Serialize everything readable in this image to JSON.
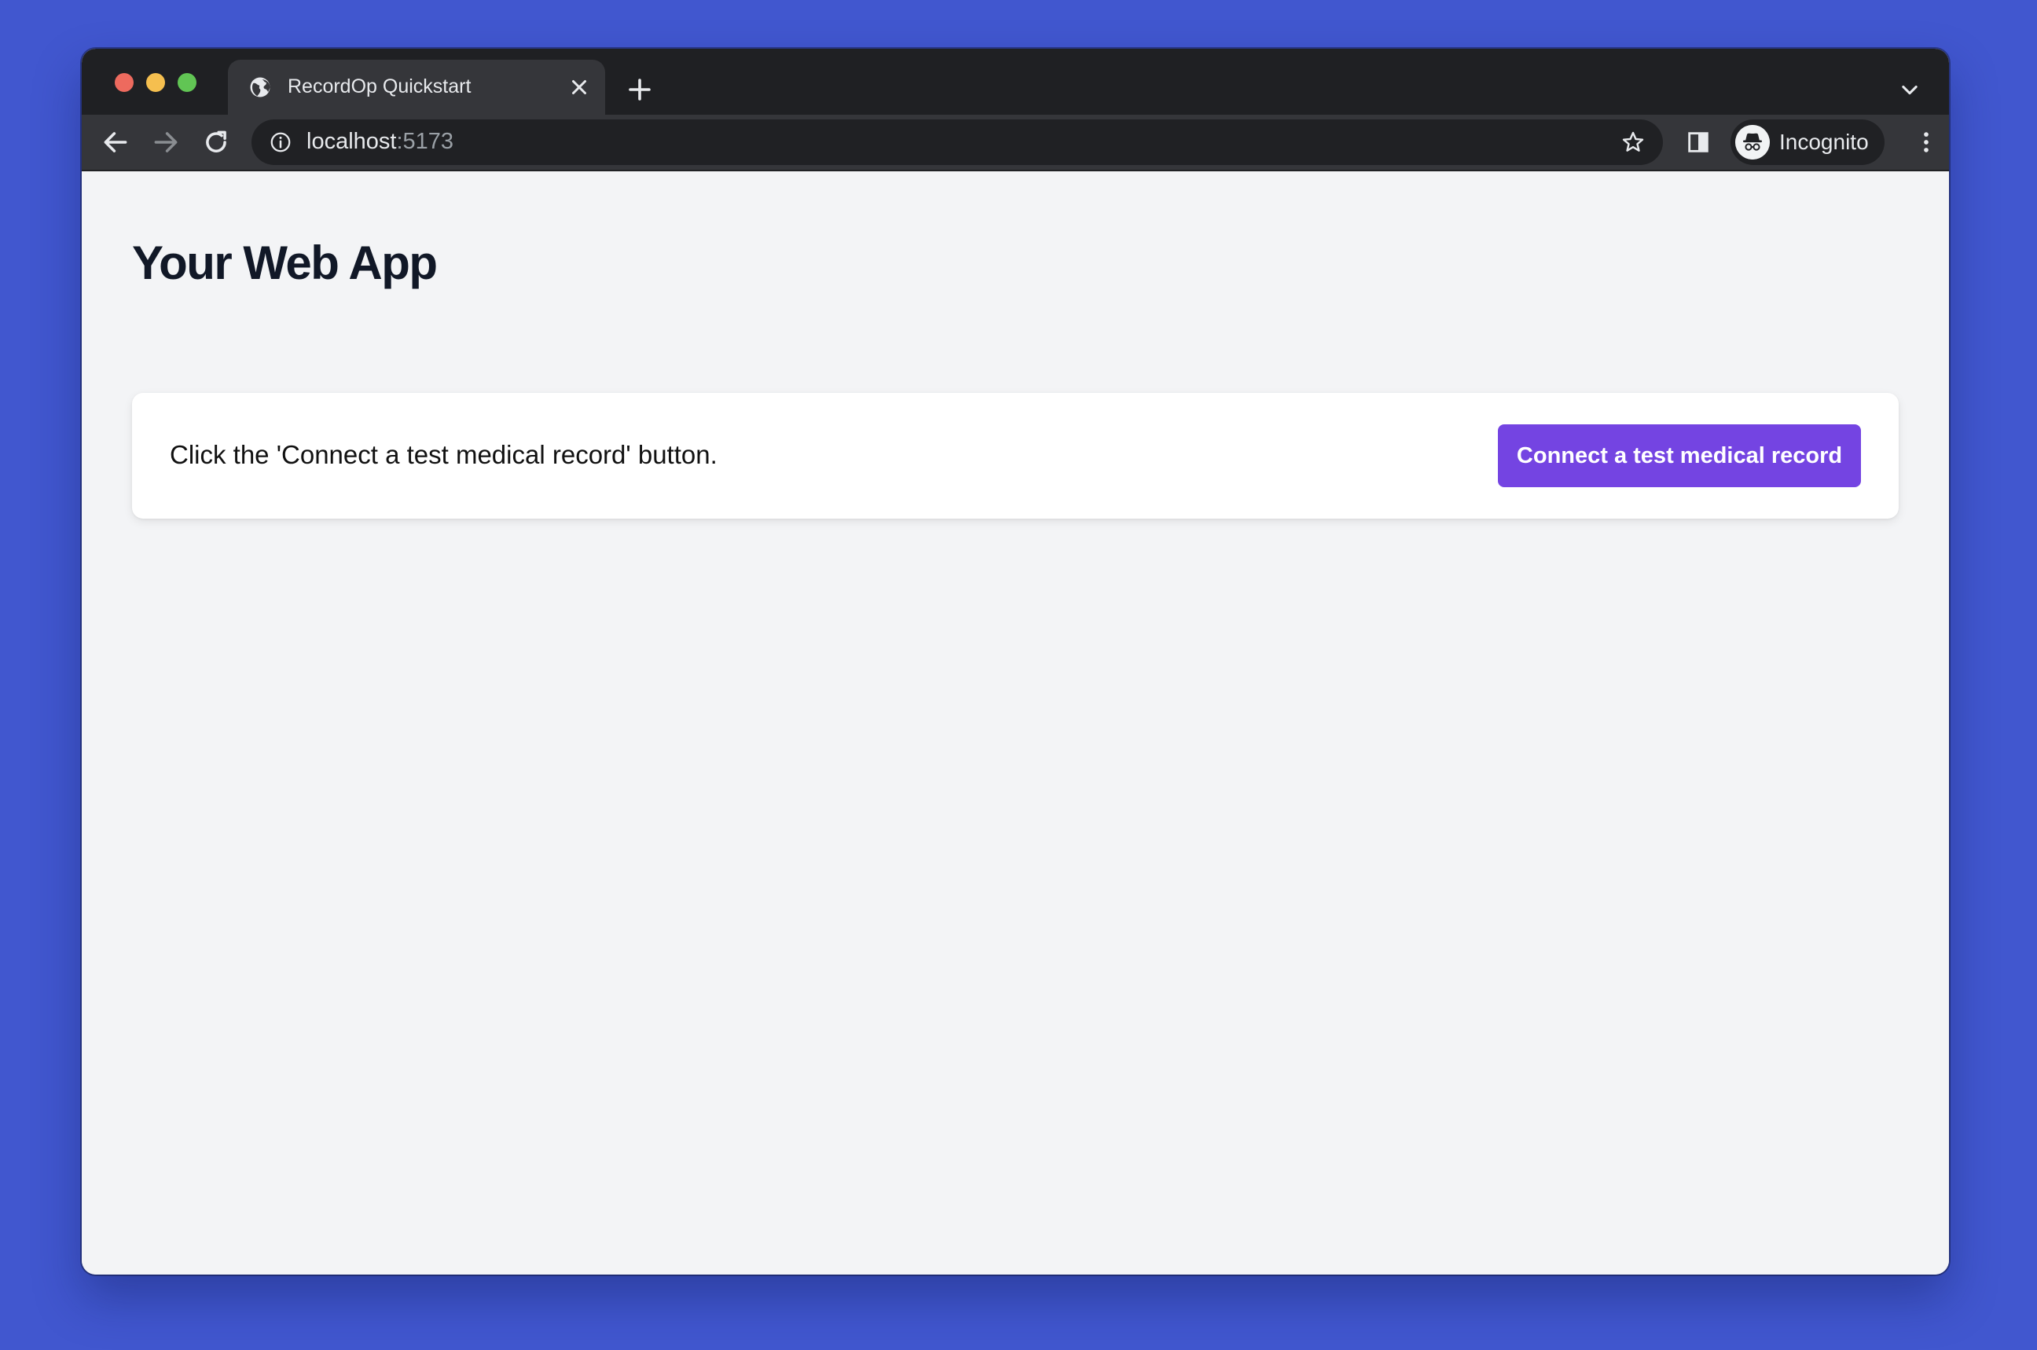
{
  "browser": {
    "tab": {
      "title": "RecordOp Quickstart",
      "favicon": "globe-icon"
    },
    "address_bar": {
      "host": "localhost",
      "port": ":5173"
    },
    "profile": {
      "label": "Incognito",
      "icon": "incognito-icon"
    },
    "icons": [
      "close-icon",
      "plus-icon",
      "chevron-down-icon",
      "back-arrow-icon",
      "forward-arrow-icon",
      "reload-icon",
      "info-icon",
      "star-icon",
      "side-panel-icon",
      "more-vert-icon"
    ]
  },
  "page": {
    "title": "Your Web App",
    "card": {
      "instruction": "Click the 'Connect a test medical record' button.",
      "button_label": "Connect a test medical record"
    }
  },
  "colors": {
    "desktop_background": "#4157cf",
    "page_background": "#f3f4f6",
    "button_background": "#7444e2",
    "traffic_red": "#ed6a5e",
    "traffic_yellow": "#f5bf4f",
    "traffic_green": "#61c554"
  }
}
